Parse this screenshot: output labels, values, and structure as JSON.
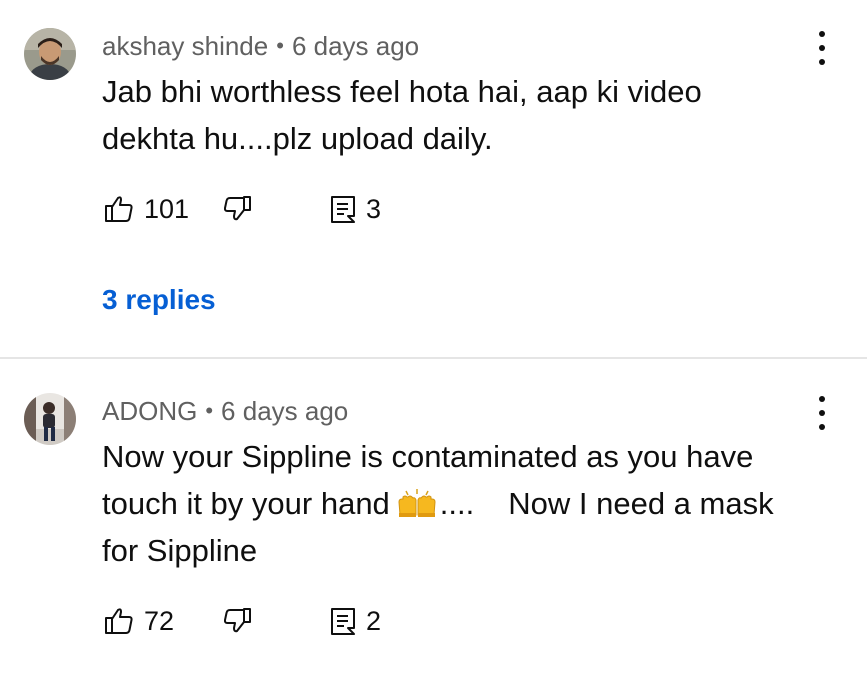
{
  "comments": [
    {
      "author": "akshay shinde",
      "separator": "•",
      "time": "6 days ago",
      "text_lines": [
        "Jab bhi worthless feel hota hai, aap ki video",
        "dekhta hu....plz upload daily."
      ],
      "likes": "101",
      "reply_count": "3",
      "replies_link": "3 replies"
    },
    {
      "author": "ADONG",
      "separator": "•",
      "time": "6 days ago",
      "text_line1": "Now your Sippline is contaminated as you have",
      "text_line2_before": "touch it by your hand",
      "text_line2_after": "....",
      "text_line2_tail": "Now I need a mask",
      "text_line3": "for Sippline",
      "emoji_icon": "raising-hands-emoji",
      "likes": "72",
      "reply_count": "2"
    }
  ],
  "colors": {
    "meta": "#606060",
    "link": "#065fd4",
    "divider": "#e5e5e5"
  }
}
